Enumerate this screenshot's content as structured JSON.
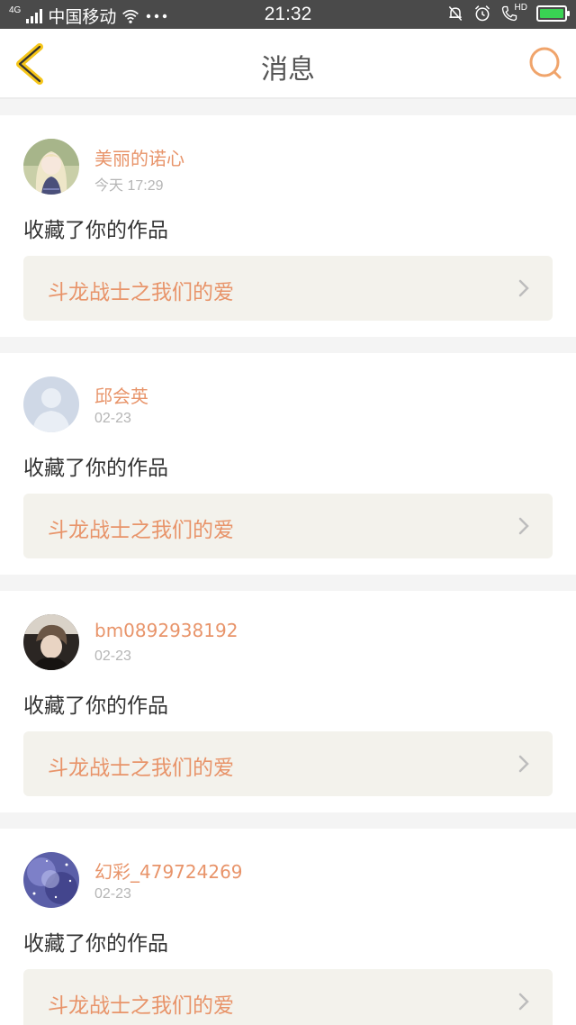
{
  "status_bar": {
    "network": "4G",
    "carrier": "中国移动",
    "time": "21:32",
    "hd": "HD"
  },
  "nav": {
    "title": "消息",
    "back_icon": "chevron-left-icon",
    "search_icon": "search-icon"
  },
  "colors": {
    "accent": "#e8946a",
    "back_arrow": "#f5c518",
    "card_inner": "#f3f2ec"
  },
  "messages": [
    {
      "username": "美丽的诺心",
      "time": "今天 17:29",
      "action": "收藏了你的作品",
      "work_title": "斗龙战士之我们的爱",
      "avatar": "anime-girl-avatar"
    },
    {
      "username": "邱会英",
      "time": "02-23",
      "action": "收藏了你的作品",
      "work_title": "斗龙战士之我们的爱",
      "avatar": "default-avatar"
    },
    {
      "username": "bm0892938192",
      "time": "02-23",
      "action": "收藏了你的作品",
      "work_title": "斗龙战士之我们的爱",
      "avatar": "anime-boy-avatar"
    },
    {
      "username": "幻彩_479724269",
      "time": "02-23",
      "action": "收藏了你的作品",
      "work_title": "斗龙战士之我们的爱",
      "avatar": "galaxy-avatar"
    }
  ]
}
